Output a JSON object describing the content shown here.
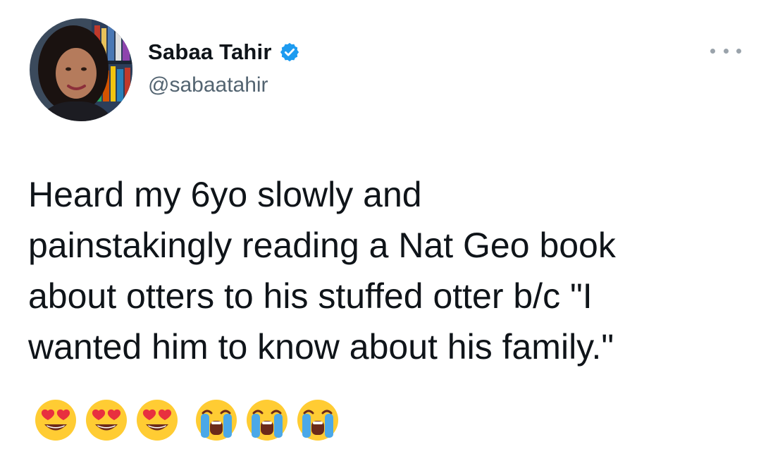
{
  "tweet": {
    "author": {
      "display_name": "Sabaa Tahir",
      "handle": "@sabaatahir",
      "verified": true,
      "avatar_icon": "profile-photo"
    },
    "more_icon": "more-options-icon",
    "text": "Heard my 6yo slowly and\npainstakingly reading a Nat Geo book\nabout otters to his stuffed otter b/c \"I\nwanted him to know about his family.\"",
    "emojis": [
      "heart-eyes-face",
      "heart-eyes-face",
      "heart-eyes-face",
      "loudly-crying-face",
      "loudly-crying-face",
      "loudly-crying-face"
    ]
  },
  "colors": {
    "text": "#0f1419",
    "secondary": "#536471",
    "verified_blue": "#1d9bf0"
  }
}
